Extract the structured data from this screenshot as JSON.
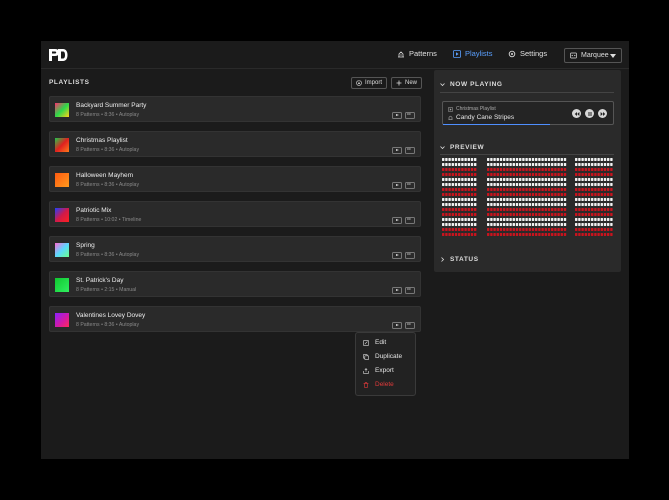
{
  "nav": {
    "patterns": "Patterns",
    "playlists": "Playlists",
    "settings": "Settings",
    "device": "Marquee"
  },
  "playlists_panel": {
    "title": "PLAYLISTS",
    "import_label": "Import",
    "new_label": "New",
    "items": [
      {
        "name": "Backyard Summer Party",
        "meta": "8 Patterns • 8:36 • Autoplay"
      },
      {
        "name": "Christmas Playlist",
        "meta": "8 Patterns • 8:36 • Autoplay"
      },
      {
        "name": "Halloween Mayhem",
        "meta": "8 Patterns • 8:36 • Autoplay"
      },
      {
        "name": "Patriotic Mix",
        "meta": "8 Patterns • 10:02 • Timeline"
      },
      {
        "name": "Spring",
        "meta": "8 Patterns • 8:36 • Autoplay"
      },
      {
        "name": "St. Patrick's Day",
        "meta": "8 Patterns • 2:15 • Manual"
      },
      {
        "name": "Valentines Lovey Dovey",
        "meta": "8 Patterns • 8:36 • Autoplay"
      }
    ]
  },
  "now_playing": {
    "title": "NOW PLAYING",
    "playlist": "Christmas Playlist",
    "track": "Candy Cane Stripes",
    "progress": 0.63
  },
  "preview": {
    "title": "PREVIEW"
  },
  "status": {
    "title": "STATUS"
  },
  "context_menu": {
    "edit": "Edit",
    "duplicate": "Duplicate",
    "export": "Export",
    "delete": "Delete"
  },
  "colors": {
    "accent": "#5aa0ff",
    "danger": "#e03a3a",
    "background": "#1b1b1b",
    "panel": "#2a2a2a"
  }
}
